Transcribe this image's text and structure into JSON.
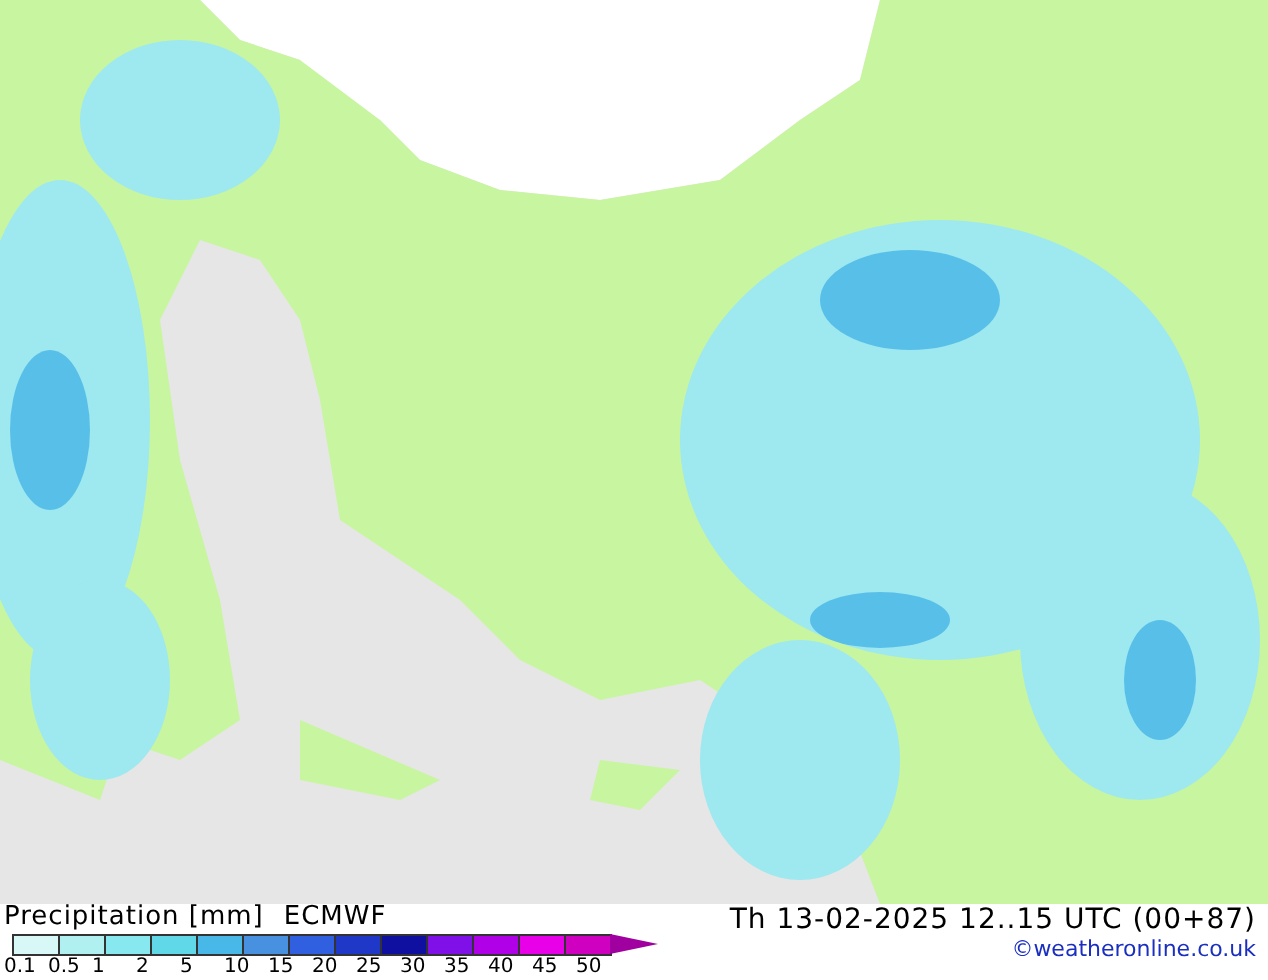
{
  "legend": {
    "title": "Precipitation [mm]",
    "model": "ECMWF",
    "bins": [
      {
        "color": "#d8f8f8"
      },
      {
        "color": "#b0f0f0"
      },
      {
        "color": "#88e8f0"
      },
      {
        "color": "#60d8e8"
      },
      {
        "color": "#48b8e8"
      },
      {
        "color": "#4890e0"
      },
      {
        "color": "#3060e0"
      },
      {
        "color": "#2038c8"
      },
      {
        "color": "#1010a0"
      },
      {
        "color": "#8010e8"
      },
      {
        "color": "#b000e8"
      },
      {
        "color": "#e800e8"
      },
      {
        "color": "#d000c0"
      }
    ],
    "labels": [
      "0.1",
      "0.5",
      "1",
      "2",
      "5",
      "10",
      "15",
      "20",
      "25",
      "30",
      "35",
      "40",
      "45",
      "50"
    ]
  },
  "valid_time": "Th 13-02-2025 12..15 UTC (00+87)",
  "credit": "©weatheronline.co.uk"
}
